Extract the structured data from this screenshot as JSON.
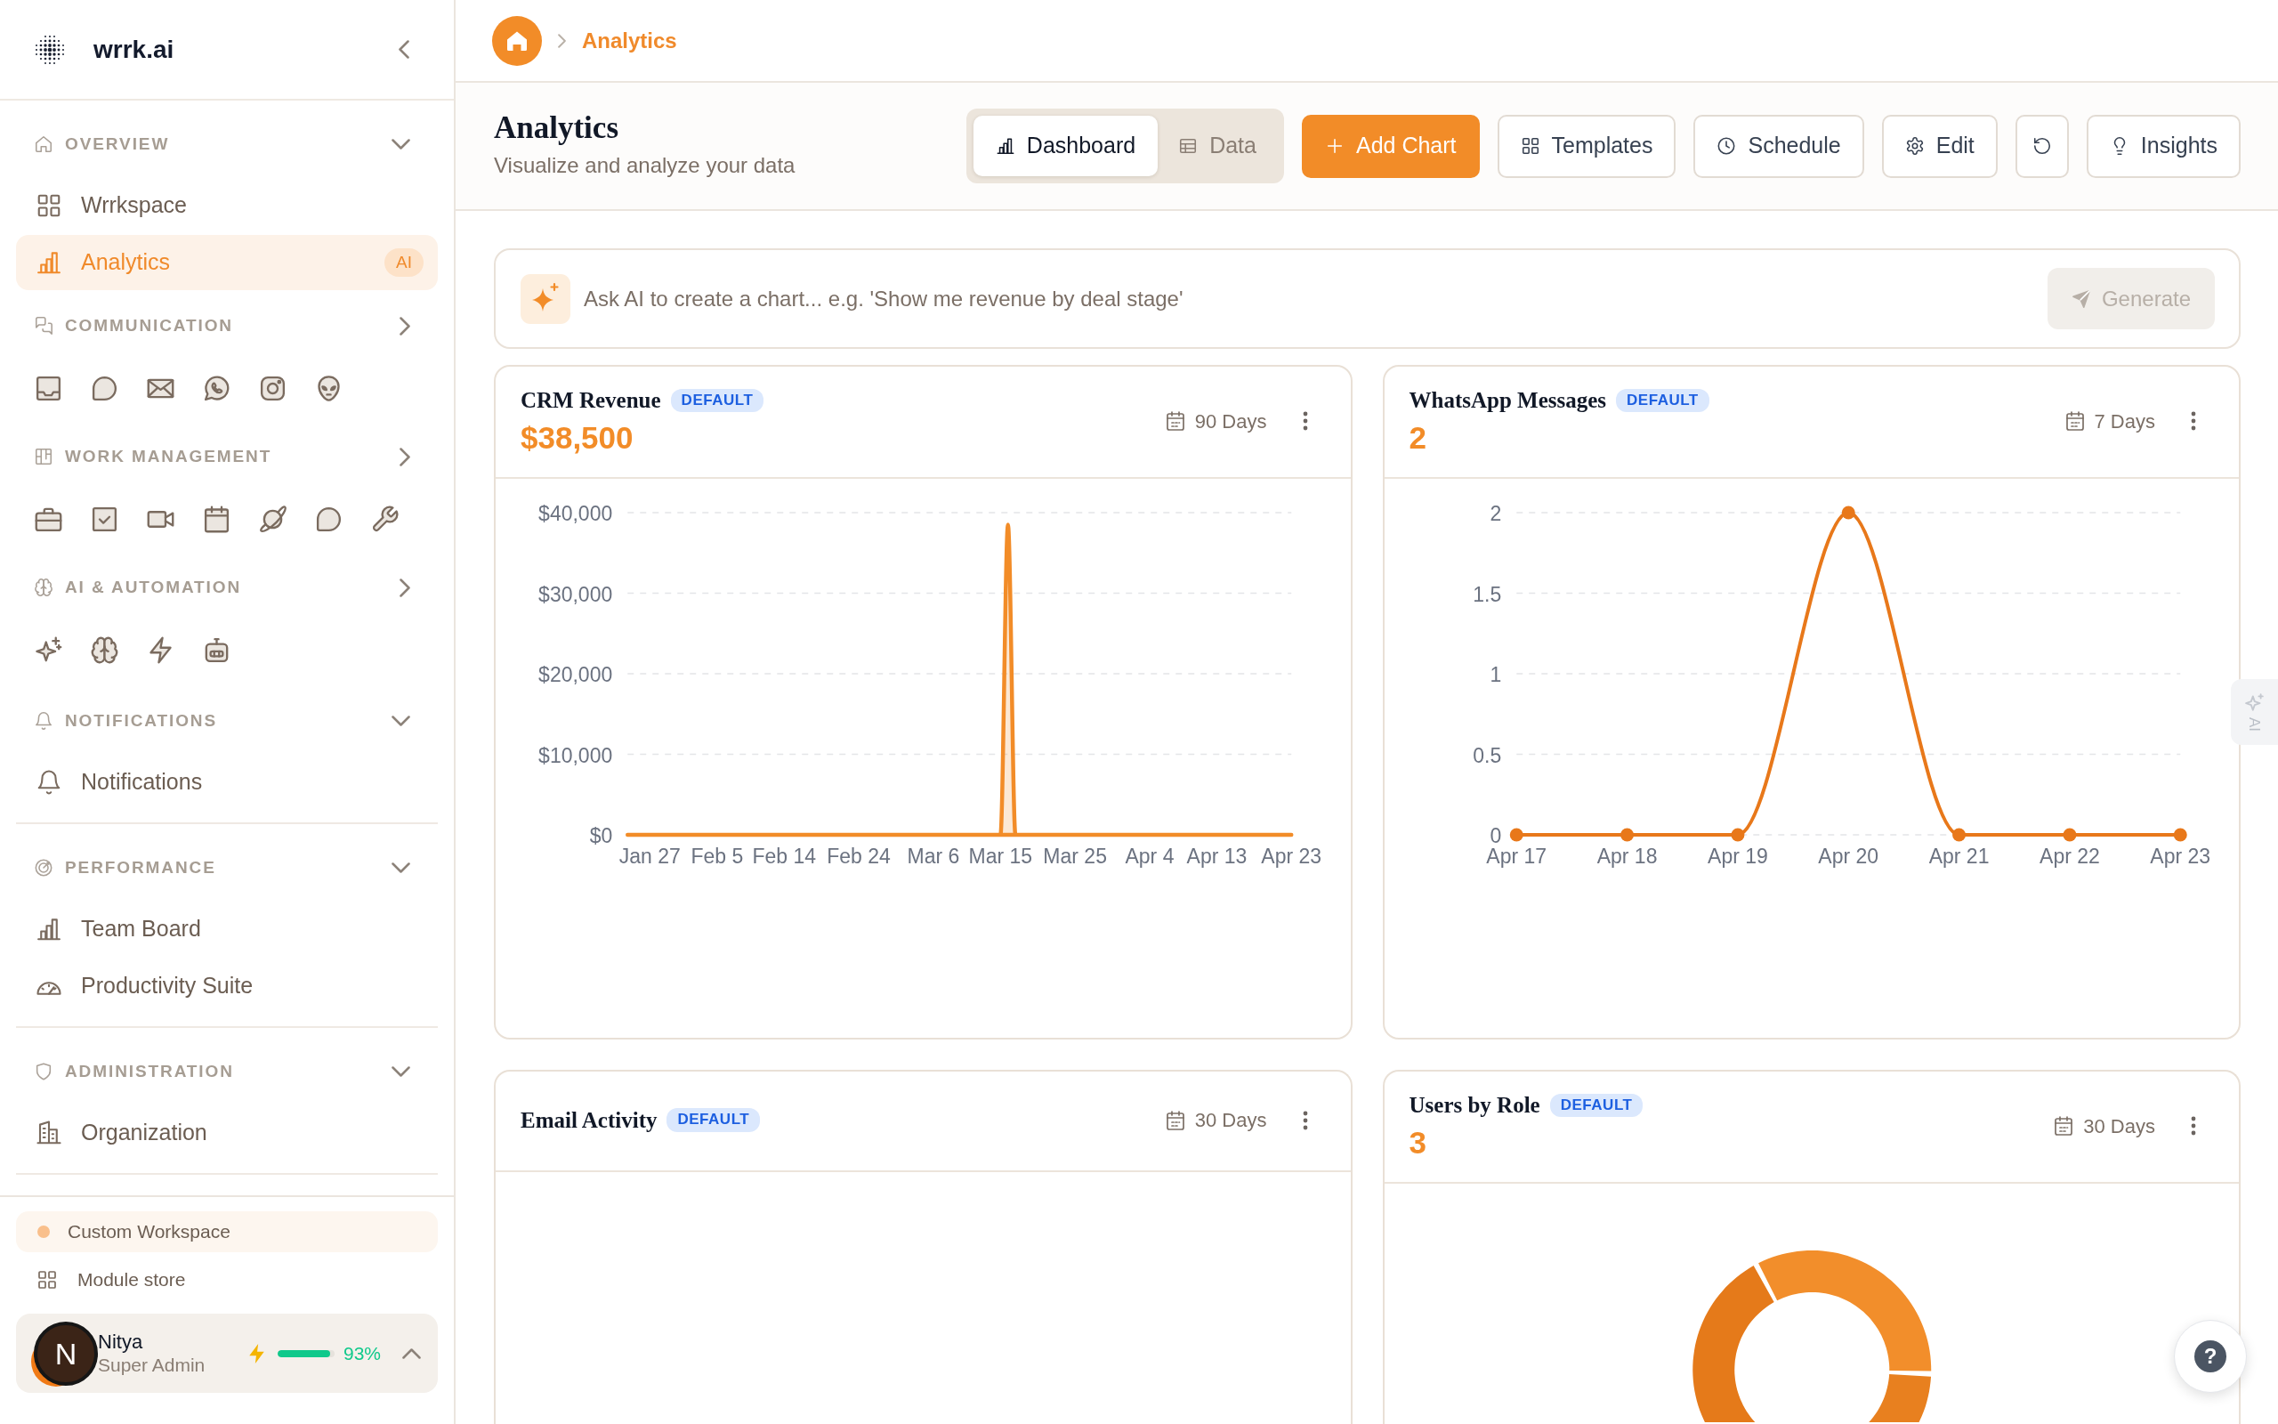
{
  "sidebar": {
    "brand": {
      "name": "wrrk.ai"
    },
    "sections": [
      {
        "label": "OVERVIEW",
        "kind": "home",
        "expanded": true,
        "divider": false,
        "items": [
          {
            "label": "Wrrkspace",
            "kind": "grid",
            "selected": false
          },
          {
            "label": "Analytics",
            "kind": "bars",
            "selected": true,
            "badge": "AI"
          }
        ]
      },
      {
        "label": "COMMUNICATION",
        "kind": "chats",
        "expanded": false,
        "divider": false,
        "shortcuts": [
          {
            "kind": "inbox"
          },
          {
            "kind": "bubble"
          },
          {
            "kind": "mail"
          },
          {
            "kind": "phonebubble"
          },
          {
            "kind": "camera"
          },
          {
            "kind": "alien"
          }
        ]
      },
      {
        "label": "WORK MANAGEMENT",
        "kind": "board",
        "expanded": false,
        "divider": false,
        "shortcuts": [
          {
            "kind": "briefcase"
          },
          {
            "kind": "checkbox"
          },
          {
            "kind": "video"
          },
          {
            "kind": "calendar"
          },
          {
            "kind": "planet"
          },
          {
            "kind": "bubble"
          },
          {
            "kind": "wrench"
          }
        ]
      },
      {
        "label": "AI & AUTOMATION",
        "kind": "brain",
        "expanded": false,
        "divider": false,
        "shortcuts": [
          {
            "kind": "sparkles"
          },
          {
            "kind": "brain"
          },
          {
            "kind": "bolt"
          },
          {
            "kind": "robot"
          }
        ]
      },
      {
        "label": "NOTIFICATIONS",
        "kind": "bell",
        "expanded": true,
        "divider": true,
        "items": [
          {
            "label": "Notifications",
            "kind": "bell",
            "selected": false
          }
        ]
      },
      {
        "label": "PERFORMANCE",
        "kind": "target",
        "expanded": true,
        "divider": true,
        "items": [
          {
            "label": "Team Board",
            "kind": "bars",
            "selected": false
          },
          {
            "label": "Productivity Suite",
            "kind": "gauge",
            "selected": false
          }
        ]
      },
      {
        "label": "ADMINISTRATION",
        "kind": "shield",
        "expanded": true,
        "divider": true,
        "items": [
          {
            "label": "Organization",
            "kind": "building",
            "selected": false
          }
        ]
      }
    ],
    "footer": {
      "workspace": {
        "label": "Custom Workspace"
      },
      "links": [
        {
          "label": "Module store",
          "kind": "grid"
        }
      ],
      "user": {
        "initial": "N",
        "name": "Nitya",
        "role": "Super Admin",
        "level": 0.93,
        "reading": "93%"
      }
    }
  },
  "breadcrumb": [
    {
      "label": "Analytics"
    }
  ],
  "page_header": {
    "title": "Analytics",
    "subtitle": "Visualize and analyze your data",
    "views": [
      {
        "label": "Dashboard",
        "kind": "bars",
        "selected": true
      },
      {
        "label": "Data",
        "kind": "table",
        "selected": false
      }
    ],
    "actions": [
      {
        "label": "Add Chart",
        "kind": "plus",
        "primary": true
      },
      {
        "label": "Templates",
        "kind": "grid",
        "primary": false
      },
      {
        "label": "Schedule",
        "kind": "clock",
        "primary": false
      },
      {
        "label": "Edit",
        "kind": "gear",
        "primary": false
      },
      {
        "kind": "refresh",
        "primary": false
      },
      {
        "label": "Insights",
        "kind": "bulb",
        "primary": false
      }
    ]
  },
  "ai_prompt": {
    "placeholder": "Ask AI to create a chart... e.g. 'Show me revenue by deal stage'",
    "button": {
      "label": "Generate",
      "disabled": true
    }
  },
  "cards": [
    {
      "kind": "area",
      "title": "CRM Revenue",
      "badge": "DEFAULT",
      "value": "$38,500",
      "range": "90 Days",
      "chart_data": {
        "type": "area",
        "grid": true,
        "categories": [
          null,
          null,
          null,
          "Jan 27",
          null,
          null,
          null,
          null,
          null,
          null,
          null,
          null,
          "Feb 5",
          null,
          null,
          null,
          null,
          null,
          null,
          null,
          null,
          "Feb 14",
          null,
          null,
          null,
          null,
          null,
          null,
          null,
          null,
          null,
          "Feb 24",
          null,
          null,
          null,
          null,
          null,
          null,
          null,
          null,
          null,
          "Mar 6",
          null,
          null,
          null,
          null,
          null,
          null,
          null,
          null,
          "Mar 15",
          null,
          null,
          null,
          null,
          null,
          null,
          null,
          null,
          null,
          "Mar 25",
          null,
          null,
          null,
          null,
          null,
          null,
          null,
          null,
          null,
          "Apr 4",
          null,
          null,
          null,
          null,
          null,
          null,
          null,
          null,
          "Apr 13",
          null,
          null,
          null,
          null,
          null,
          null,
          null,
          null,
          null,
          "Apr 23"
        ],
        "series": [
          {
            "color": "#f28c28",
            "values": [
              0,
              0,
              0,
              0,
              0,
              0,
              0,
              0,
              0,
              0,
              0,
              0,
              0,
              0,
              0,
              0,
              0,
              0,
              0,
              0,
              0,
              0,
              0,
              0,
              0,
              0,
              0,
              0,
              0,
              0,
              0,
              0,
              0,
              0,
              0,
              0,
              0,
              0,
              0,
              0,
              0,
              0,
              0,
              0,
              0,
              0,
              0,
              0,
              0,
              0,
              0,
              38500,
              0,
              0,
              0,
              0,
              0,
              0,
              0,
              0,
              0,
              0,
              0,
              0,
              0,
              0,
              0,
              0,
              0,
              0,
              0,
              0,
              0,
              0,
              0,
              0,
              0,
              0,
              0,
              0,
              0,
              0,
              0,
              0,
              0,
              0,
              0,
              0,
              0,
              0
            ]
          }
        ],
        "ylim": [
          0,
          40000
        ],
        "yticks": [
          {
            "value": 0,
            "label": "$0"
          },
          {
            "value": 10000,
            "label": "$10,000"
          },
          {
            "value": 20000,
            "label": "$20,000"
          },
          {
            "value": 30000,
            "label": "$30,000"
          },
          {
            "value": 40000,
            "label": "$40,000"
          }
        ]
      }
    },
    {
      "kind": "blank",
      "title": "Email Activity",
      "badge": "DEFAULT",
      "range": "30 Days"
    },
    {
      "kind": "line",
      "title": "WhatsApp Messages",
      "badge": "DEFAULT",
      "value": "2",
      "range": "7 Days",
      "chart_data": {
        "type": "line",
        "grid": true,
        "categories": [
          "Apr 17",
          "Apr 18",
          "Apr 19",
          "Apr 20",
          "Apr 21",
          "Apr 22",
          "Apr 23"
        ],
        "series": [
          {
            "color": "#e8781a",
            "marker": "circle",
            "values": [
              0,
              0,
              0,
              2,
              0,
              0,
              0
            ]
          }
        ],
        "ylim": [
          0,
          2
        ],
        "yticks": [
          0,
          0.5,
          1,
          1.5,
          2
        ]
      }
    },
    {
      "kind": "donut",
      "title": "Users by Role",
      "badge": "DEFAULT",
      "value": "3",
      "range": "30 Days"
    }
  ],
  "ai_side_tab": {
    "label": "AI"
  },
  "help": {
    "label": "?"
  }
}
